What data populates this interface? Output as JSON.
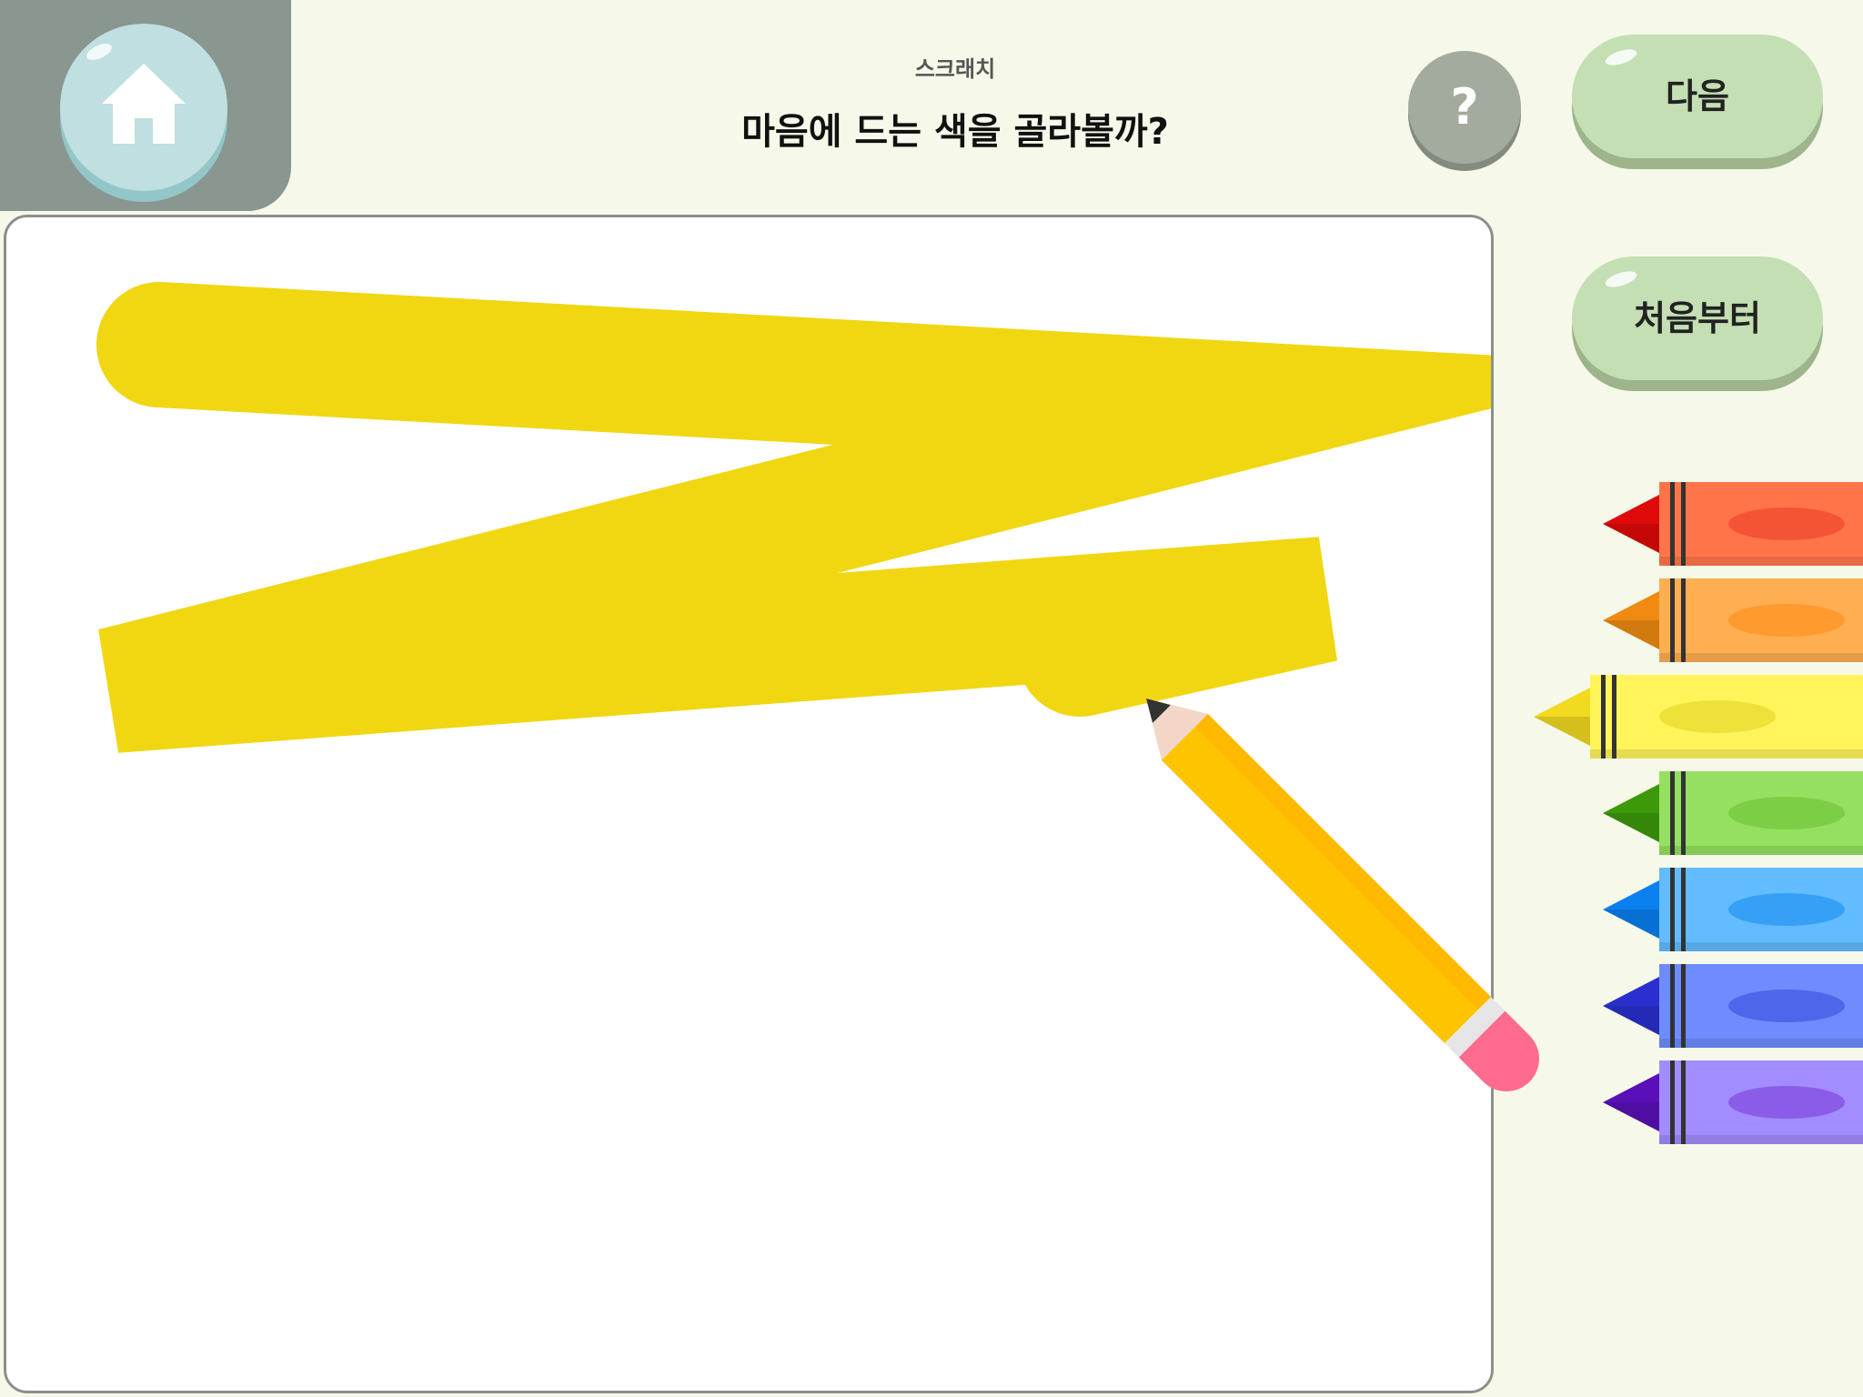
{
  "header": {
    "subtitle": "스크래치",
    "question": "마음에 드는 색을 골라볼까?",
    "help_label": "?",
    "next_label": "다음"
  },
  "sidebar": {
    "restart_label": "처음부터"
  },
  "icons": {
    "home": "home-icon",
    "help": "question-icon",
    "pencil": "pencil-icon"
  },
  "stroke_color": "#f0d712",
  "crayons": [
    {
      "name": "red",
      "tip": "#e00a0a",
      "body": "#ff7549",
      "oval": "#f55335",
      "selected": false
    },
    {
      "name": "orange",
      "tip": "#f08a12",
      "body": "#ffae52",
      "oval": "#ff9a2e",
      "selected": false
    },
    {
      "name": "yellow",
      "tip": "#f2da20",
      "body": "#fff45a",
      "oval": "#eee13a",
      "selected": true
    },
    {
      "name": "green",
      "tip": "#3c9a0a",
      "body": "#95e060",
      "oval": "#7ccf45",
      "selected": false
    },
    {
      "name": "sky-blue",
      "tip": "#0a80f0",
      "body": "#63bcff",
      "oval": "#35a0f5",
      "selected": false
    },
    {
      "name": "blue",
      "tip": "#2a2fd0",
      "body": "#6e8cff",
      "oval": "#4d66ea",
      "selected": false
    },
    {
      "name": "purple",
      "tip": "#5a0fb8",
      "body": "#a38cff",
      "oval": "#8a5ce8",
      "selected": false
    }
  ]
}
